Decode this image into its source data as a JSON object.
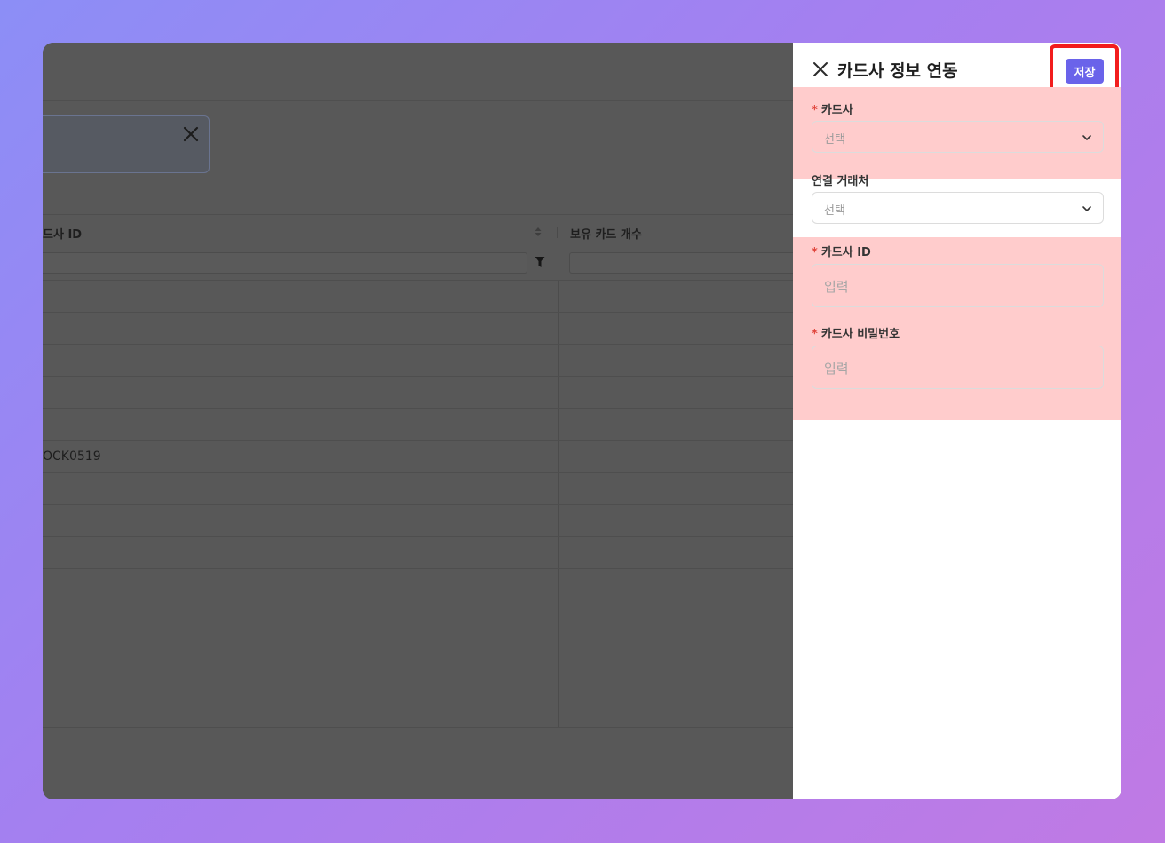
{
  "background_app": {
    "columns": [
      {
        "label": "드사 ID"
      },
      {
        "label": "보유 카드 개수"
      }
    ],
    "visible_cell": "OCK0519"
  },
  "drawer": {
    "title": "카드사 정보 연동",
    "save_label": "저장",
    "required_mark": "*",
    "fields": {
      "card_company": {
        "label": "카드사",
        "value": "선택"
      },
      "partner": {
        "label": "연결 거래처",
        "value": "선택"
      },
      "card_id": {
        "label": "카드사 ID",
        "placeholder": "입력"
      },
      "card_password": {
        "label": "카드사 비밀번호",
        "placeholder": "입력"
      }
    }
  },
  "colors": {
    "accent": "#6a63ea",
    "required": "#e0453c",
    "highlight_border": "#f21d1d",
    "highlight_fill": "#ffcccc",
    "overlay": "#585858"
  },
  "icons": {
    "close": "close-icon",
    "chevron": "chevron-down-icon",
    "filter": "filter-icon",
    "sort": "sort-icon"
  }
}
